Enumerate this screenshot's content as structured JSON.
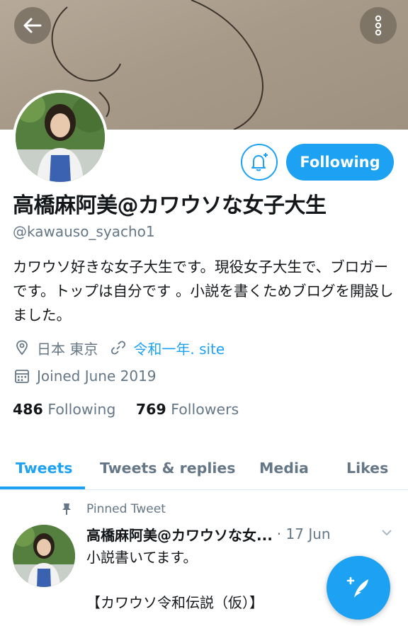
{
  "header": {
    "back_icon": "arrow-left-icon",
    "more_icon": "more-vertical-icon"
  },
  "profile": {
    "display_name": "高橋麻阿美@カワウソな女子大生",
    "handle": "@kawauso_syacho1",
    "bio": "カワウソ好きな女子大生です。現役女子大生で、ブロガーです。トップは自分です 。小説を書くためブログを開設しました。",
    "location": "日本 東京",
    "website": "令和一年. site",
    "joined": "Joined June 2019",
    "following_count": "486",
    "following_label": "Following",
    "followers_count": "769",
    "followers_label": "Followers",
    "follow_button_label": "Following",
    "bell_icon": "notification-bell-plus-icon"
  },
  "tabs": [
    {
      "label": "Tweets",
      "active": true
    },
    {
      "label": "Tweets & replies",
      "active": false
    },
    {
      "label": "Media",
      "active": false
    },
    {
      "label": "Likes",
      "active": false
    }
  ],
  "pinned_tweet": {
    "pinned_label": "Pinned Tweet",
    "author": "高橋麻阿美@カワウソな女...",
    "date": "· 17 Jun",
    "text": "小説書いてます。\n\n【カワウソ令和伝説（仮）】"
  },
  "colors": {
    "accent": "#1da1f2",
    "secondary_text": "#657786",
    "primary_text": "#14171a"
  },
  "fab": {
    "icon": "compose-tweet-icon"
  }
}
